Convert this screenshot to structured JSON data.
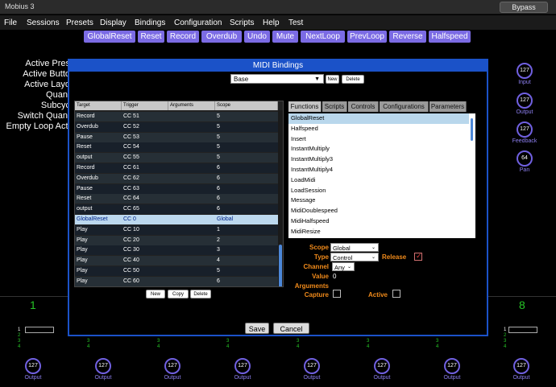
{
  "app": {
    "title": "Mobius 3",
    "bypass_label": "Bypass"
  },
  "menu": [
    "File",
    "Sessions",
    "Presets",
    "Display",
    "Bindings",
    "Configuration",
    "Scripts",
    "Help",
    "Test"
  ],
  "toolbar": [
    "GlobalReset",
    "Reset",
    "Record",
    "Overdub",
    "Undo",
    "Mute",
    "NextLoop",
    "PrevLoop",
    "Reverse",
    "Halfspeed"
  ],
  "left_labels": [
    "Active Pres",
    "Active Butto",
    "Active Layo",
    "Quant",
    "Subcyc",
    "Switch Quant",
    "Empty Loop Acti"
  ],
  "right_knobs": [
    {
      "value": "127",
      "label": "Input"
    },
    {
      "value": "127",
      "label": "Output"
    },
    {
      "value": "127",
      "label": "Feedback"
    },
    {
      "value": "64",
      "label": "Pan"
    }
  ],
  "dialog": {
    "title": "MIDI Bindings",
    "binding_set": "Base",
    "new_label": "New",
    "delete_label": "Delete",
    "table": {
      "headers": [
        "Target",
        "Trigger",
        "Arguments",
        "Scope"
      ],
      "rows": [
        [
          "Record",
          "CC 51",
          "",
          "5"
        ],
        [
          "Overdub",
          "CC 52",
          "",
          "5"
        ],
        [
          "Pause",
          "CC 53",
          "",
          "5"
        ],
        [
          "Reset",
          "CC 54",
          "",
          "5"
        ],
        [
          "output",
          "CC 55",
          "",
          "5"
        ],
        [
          "Record",
          "CC 61",
          "",
          "6"
        ],
        [
          "Overdub",
          "CC 62",
          "",
          "6"
        ],
        [
          "Pause",
          "CC 63",
          "",
          "6"
        ],
        [
          "Reset",
          "CC 64",
          "",
          "6"
        ],
        [
          "output",
          "CC 65",
          "",
          "6"
        ],
        [
          "GlobalReset",
          "CC 0",
          "",
          "Global"
        ],
        [
          "Play",
          "CC 10",
          "",
          "1"
        ],
        [
          "Play",
          "CC 20",
          "",
          "2"
        ],
        [
          "Play",
          "CC 30",
          "",
          "3"
        ],
        [
          "Play",
          "CC 40",
          "",
          "4"
        ],
        [
          "Play",
          "CC 50",
          "",
          "5"
        ],
        [
          "Play",
          "CC 60",
          "",
          "6"
        ]
      ],
      "selected_row": 10
    },
    "table_buttons": {
      "new": "New",
      "copy": "Copy",
      "delete": "Delete"
    },
    "tabs": [
      "Functions",
      "Scripts",
      "Controls",
      "Configurations",
      "Parameters"
    ],
    "functions": [
      "GlobalReset",
      "Halfspeed",
      "Insert",
      "InstantMultiply",
      "InstantMultiply3",
      "InstantMultiply4",
      "LoadMidi",
      "LoadSession",
      "Message",
      "MidiDoublespeed",
      "MidiHalfspeed",
      "MidiResize"
    ],
    "props": {
      "scope_label": "Scope",
      "scope_value": "Global",
      "type_label": "Type",
      "type_value": "Control",
      "release_label": "Release",
      "release_checked": true,
      "channel_label": "Channel",
      "channel_value": "Any",
      "value_label": "Value",
      "value_value": "0",
      "arguments_label": "Arguments",
      "capture_label": "Capture",
      "capture_checked": false,
      "active_label": "Active",
      "active_checked": false
    },
    "save_label": "Save",
    "cancel_label": "Cancel"
  },
  "tracks": {
    "left_number": "1",
    "right_number": "8",
    "mini_numbers": [
      "1",
      "2",
      "3",
      "4"
    ],
    "knob_value": "127",
    "knob_label": "Output"
  },
  "colors": {
    "accent": "#7b6be4",
    "dialog_blue": "#1b52c8",
    "prop_label": "#f08a1a",
    "track_green": "#26c326"
  }
}
